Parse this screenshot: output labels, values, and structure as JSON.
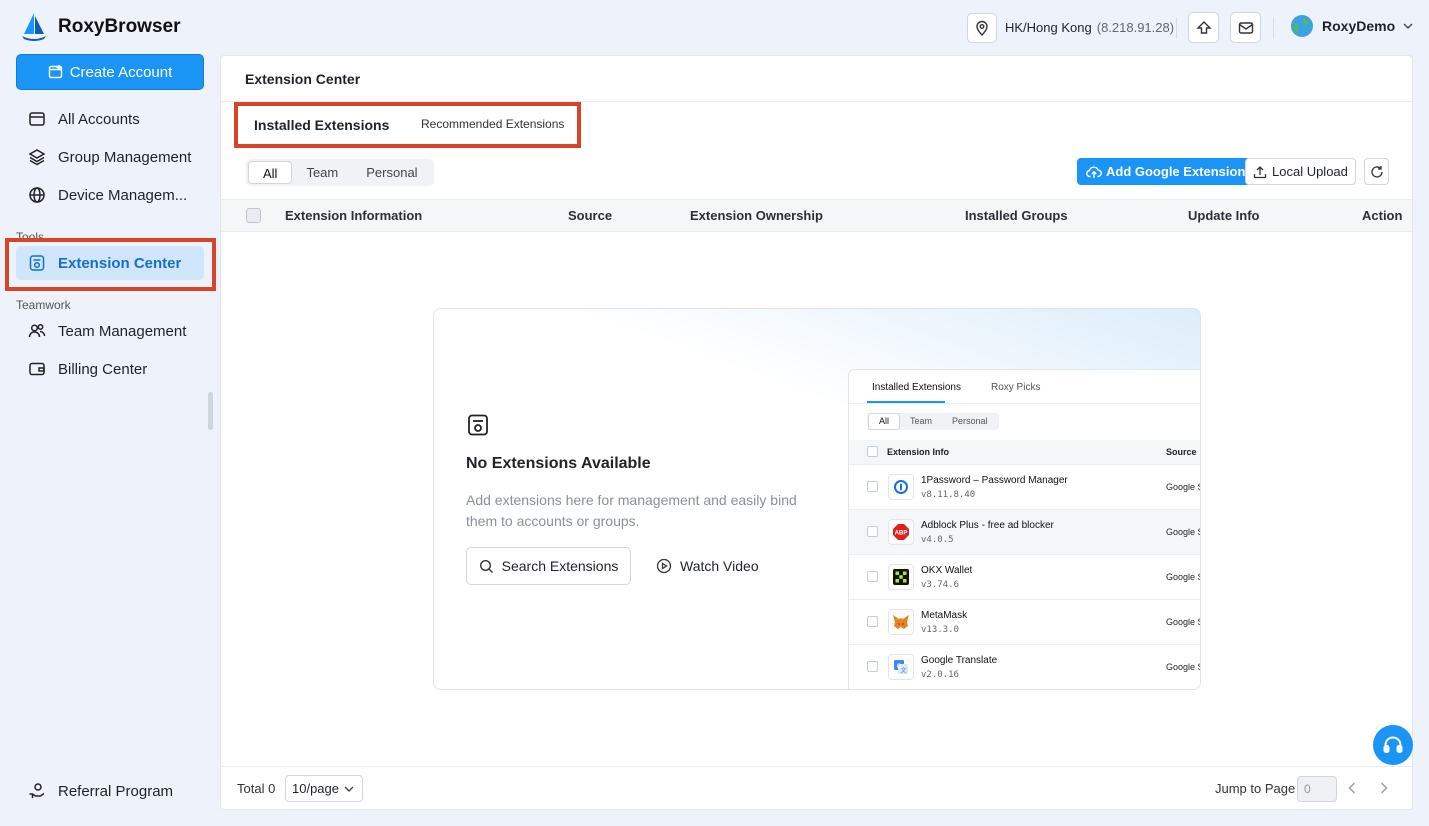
{
  "app": {
    "name": "RoxyBrowser"
  },
  "sidebar": {
    "create_label": "Create Account",
    "items": [
      {
        "label": "All Accounts"
      },
      {
        "label": "Group Management"
      },
      {
        "label": "Device Managem..."
      }
    ],
    "tools_label": "Tools",
    "tools_items": [
      {
        "label": "Extension Center"
      }
    ],
    "teamwork_label": "Teamwork",
    "teamwork_items": [
      {
        "label": "Team Management"
      },
      {
        "label": "Billing Center"
      }
    ],
    "referral_label": "Referral Program"
  },
  "header": {
    "location": "HK/Hong Kong",
    "ip": "(8.218.91.28)",
    "user": "RoxyDemo"
  },
  "main": {
    "title": "Extension Center",
    "tabs": [
      {
        "label": "Installed Extensions"
      },
      {
        "label": "Recommended Extensions"
      }
    ],
    "filters": [
      "All",
      "Team",
      "Personal"
    ],
    "add_google_label": "Add Google Extension",
    "local_upload_label": "Local Upload",
    "columns": [
      "Extension Information",
      "Source",
      "Extension Ownership",
      "Installed Groups",
      "Update Info",
      "Action"
    ],
    "empty": {
      "title": "No Extensions Available",
      "description": "Add extensions here for management and easily bind them to accounts or groups.",
      "search_label": "Search Extensions",
      "video_label": "Watch Video"
    },
    "preview": {
      "tabs": [
        "Installed Extensions",
        "Roxy Picks"
      ],
      "filters": [
        "All",
        "Team",
        "Personal"
      ],
      "col_info": "Extension Info",
      "col_source": "Source",
      "rows": [
        {
          "name": "1Password – Password Manager",
          "version": "v8.11.8.40",
          "source": "Google S",
          "icon": "1password-icon"
        },
        {
          "name": "Adblock Plus - free ad blocker",
          "version": "v4.0.5",
          "source": "Google S",
          "icon": "abp-icon"
        },
        {
          "name": "OKX Wallet",
          "version": "v3.74.6",
          "source": "Google S",
          "icon": "okx-icon"
        },
        {
          "name": "MetaMask",
          "version": "v13.3.0",
          "source": "Google S",
          "icon": "metamask-icon"
        },
        {
          "name": "Google Translate",
          "version": "v2.0.16",
          "source": "Google S",
          "icon": "google-translate-icon"
        }
      ]
    },
    "footer": {
      "total": "Total 0",
      "per_page": "10/page",
      "jump_label": "Jump to Page",
      "page_placeholder": "0"
    }
  },
  "colors": {
    "accent": "#1a95f5",
    "highlight_box": "#d8442a",
    "active_bg": "#cfe6fb"
  }
}
